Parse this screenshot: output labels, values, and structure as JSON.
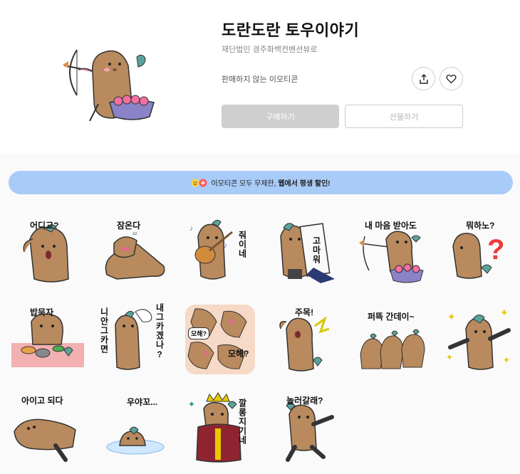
{
  "product": {
    "title": "도란도란 토우이야기",
    "author": "재단법인 경주화백컨벤션뷰로",
    "status_text": "판매하지 않는 이모티콘"
  },
  "actions": {
    "share_icon": "share-icon",
    "like_icon": "heart-icon",
    "buy_label": "구매하기",
    "gift_label": "선물하기"
  },
  "banner": {
    "prefix": "이모티콘 모두 무제한,",
    "highlight": "웹에서 평생 할인!"
  },
  "stickers": [
    {
      "caption": "어디교?"
    },
    {
      "caption": "잠온다"
    },
    {
      "caption": "줘이네"
    },
    {
      "caption": "고마워"
    },
    {
      "caption": "내 마음 받아도"
    },
    {
      "caption": "뭐하노?"
    },
    {
      "caption": "밥묵자"
    },
    {
      "caption": "니안그카면",
      "caption2": "내그카겠나?"
    },
    {
      "caption": "모해?",
      "caption2": "모해?"
    },
    {
      "caption": "주목!"
    },
    {
      "caption": "퍼뜩 간데이~"
    },
    {
      "caption": ""
    },
    {
      "caption": "아이고 되다"
    },
    {
      "caption": "우야꼬..."
    },
    {
      "caption": "깔롱지기네"
    },
    {
      "caption": "놀러갈래?"
    }
  ],
  "colors": {
    "toy": "#b88a5d",
    "toy_dark": "#7a5433",
    "bird": "#5aa39a",
    "banner": "#a9cbf8",
    "buy_disabled": "#cfcfcf"
  }
}
